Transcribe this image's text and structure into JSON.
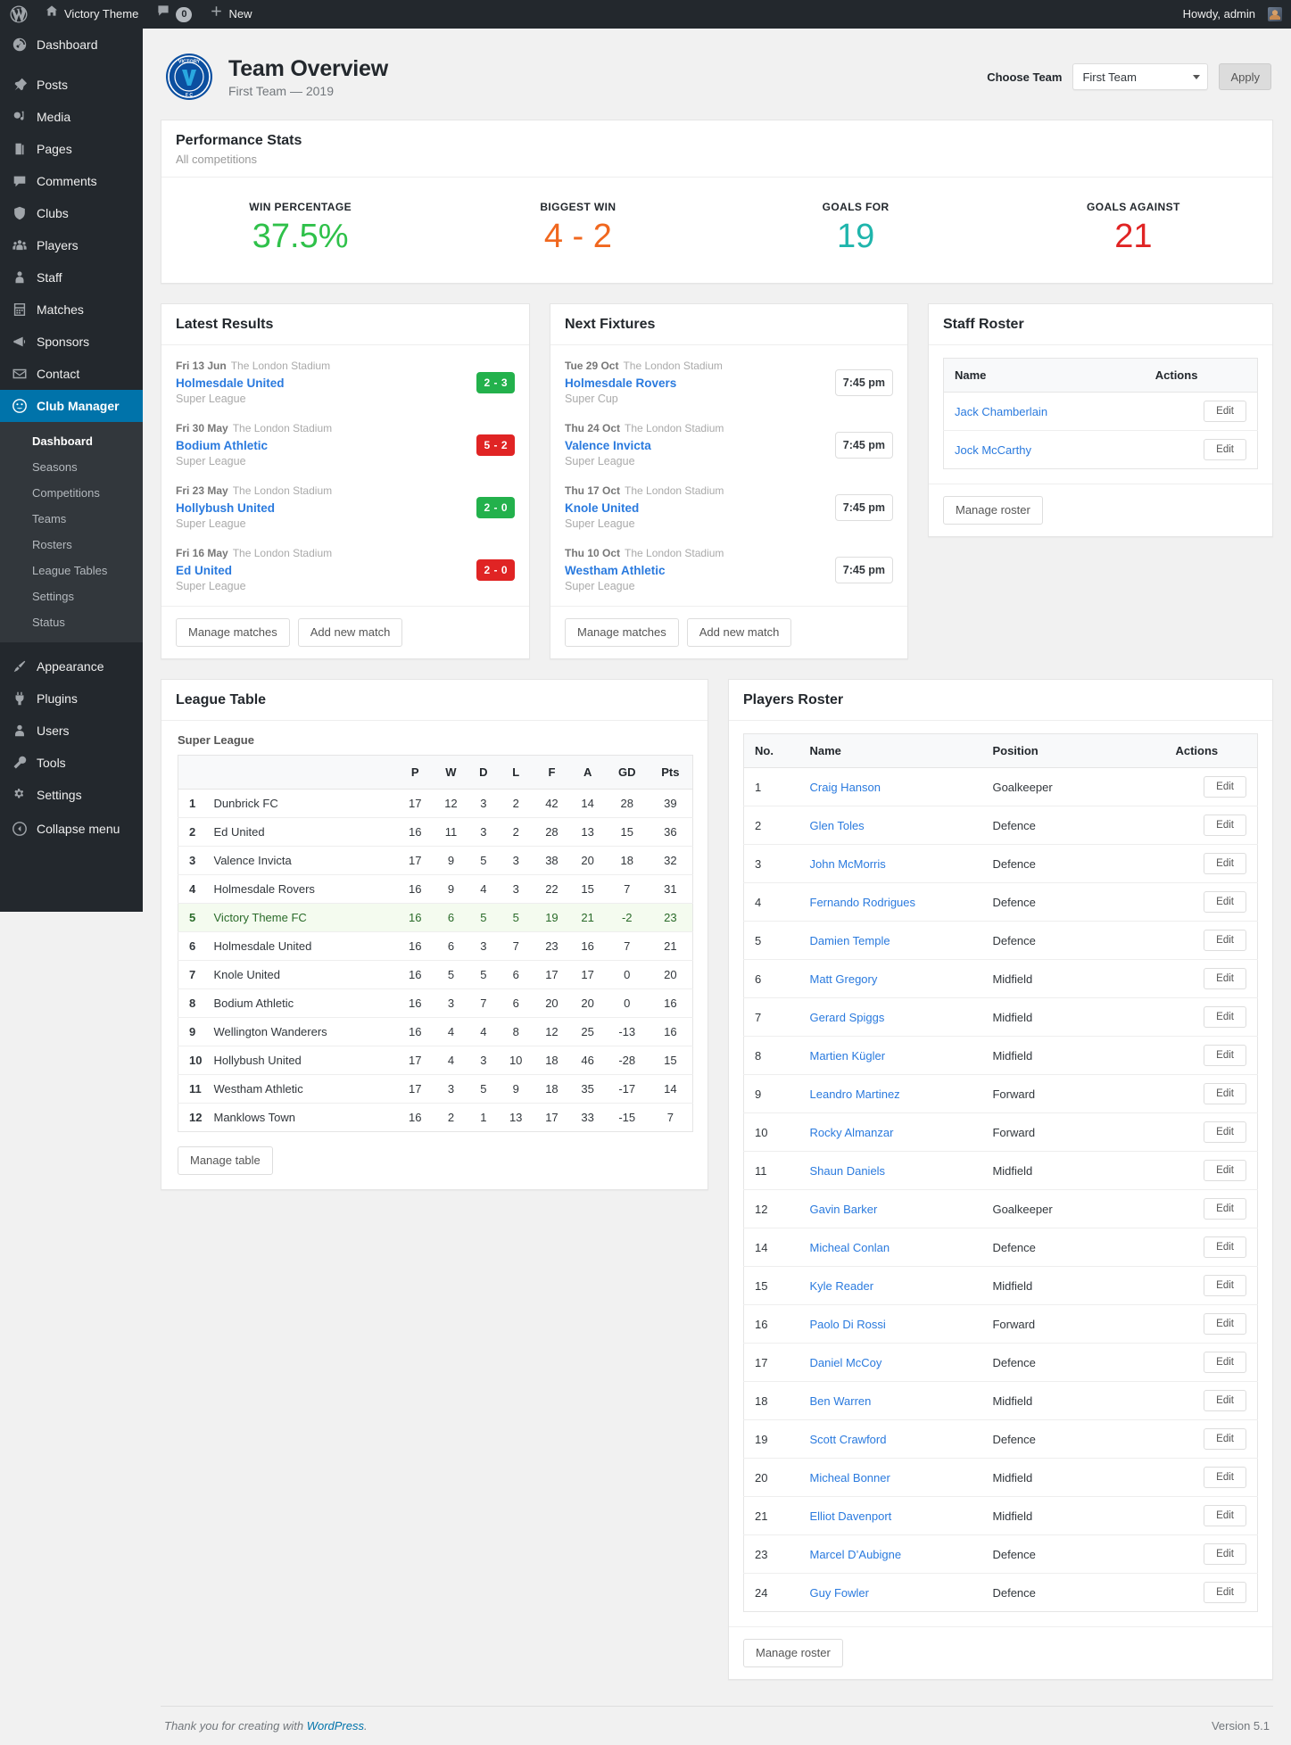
{
  "adminbar": {
    "logo_icon": "wordpress-logo-icon",
    "site_icon": "home-icon",
    "site_name": "Victory Theme",
    "comments_icon": "comment-bubble-icon",
    "comments_count": "0",
    "new_icon": "plus-icon",
    "new_label": "New",
    "howdy": "Howdy, admin",
    "avatar_icon": "user-avatar"
  },
  "sidebar": {
    "items": [
      {
        "label": "Dashboard",
        "icon": "dashboard-icon"
      },
      {
        "label": "Posts",
        "icon": "pin-icon"
      },
      {
        "label": "Media",
        "icon": "media-icon"
      },
      {
        "label": "Pages",
        "icon": "pages-icon"
      },
      {
        "label": "Comments",
        "icon": "comment-icon"
      },
      {
        "label": "Clubs",
        "icon": "shield-icon"
      },
      {
        "label": "Players",
        "icon": "group-icon"
      },
      {
        "label": "Staff",
        "icon": "person-icon"
      },
      {
        "label": "Matches",
        "icon": "calendar-icon"
      },
      {
        "label": "Sponsors",
        "icon": "megaphone-icon"
      },
      {
        "label": "Contact",
        "icon": "envelope-icon"
      }
    ],
    "club_manager": {
      "label": "Club Manager",
      "icon": "club-manager-icon"
    },
    "submenu": [
      {
        "label": "Dashboard",
        "current": true
      },
      {
        "label": "Seasons",
        "current": false
      },
      {
        "label": "Competitions",
        "current": false
      },
      {
        "label": "Teams",
        "current": false
      },
      {
        "label": "Rosters",
        "current": false
      },
      {
        "label": "League Tables",
        "current": false
      },
      {
        "label": "Settings",
        "current": false
      },
      {
        "label": "Status",
        "current": false
      }
    ],
    "bottom_items": [
      {
        "label": "Appearance",
        "icon": "paintbrush-icon"
      },
      {
        "label": "Plugins",
        "icon": "plug-icon"
      },
      {
        "label": "Users",
        "icon": "users-icon"
      },
      {
        "label": "Tools",
        "icon": "wrench-icon"
      },
      {
        "label": "Settings",
        "icon": "settings-gear-icon"
      }
    ],
    "collapse": {
      "label": "Collapse menu",
      "icon": "collapse-icon"
    }
  },
  "header": {
    "crest_icon": "victory-fc-crest",
    "title": "Team Overview",
    "subtitle": "First Team — 2019",
    "chooser_label": "Choose Team",
    "selected_team": "First Team",
    "apply_label": "Apply"
  },
  "performance": {
    "title": "Performance Stats",
    "subtitle": "All competitions",
    "stats": [
      {
        "label": "WIN PERCENTAGE",
        "value": "37.5%",
        "color": "#2fc14a"
      },
      {
        "label": "BIGGEST WIN",
        "value": "4 - 2",
        "color": "#f0671e"
      },
      {
        "label": "GOALS FOR",
        "value": "19",
        "color": "#1fb5ac"
      },
      {
        "label": "GOALS AGAINST",
        "value": "21",
        "color": "#e02424"
      }
    ]
  },
  "latest_results": {
    "title": "Latest Results",
    "matches": [
      {
        "date": "Fri 13 Jun",
        "venue": "The London Stadium",
        "team": "Holmesdale United",
        "competition": "Super League",
        "score": "2 - 3",
        "outcome": "win"
      },
      {
        "date": "Fri 30 May",
        "venue": "The London Stadium",
        "team": "Bodium Athletic",
        "competition": "Super League",
        "score": "5 - 2",
        "outcome": "loss"
      },
      {
        "date": "Fri 23 May",
        "venue": "The London Stadium",
        "team": "Hollybush United",
        "competition": "Super League",
        "score": "2 - 0",
        "outcome": "win"
      },
      {
        "date": "Fri 16 May",
        "venue": "The London Stadium",
        "team": "Ed United",
        "competition": "Super League",
        "score": "2 - 0",
        "outcome": "loss"
      }
    ],
    "manage_label": "Manage matches",
    "add_label": "Add new match"
  },
  "next_fixtures": {
    "title": "Next Fixtures",
    "matches": [
      {
        "date": "Tue 29 Oct",
        "venue": "The London Stadium",
        "team": "Holmesdale Rovers",
        "competition": "Super Cup",
        "time": "7:45 pm"
      },
      {
        "date": "Thu 24 Oct",
        "venue": "The London Stadium",
        "team": "Valence Invicta",
        "competition": "Super League",
        "time": "7:45 pm"
      },
      {
        "date": "Thu 17 Oct",
        "venue": "The London Stadium",
        "team": "Knole United",
        "competition": "Super League",
        "time": "7:45 pm"
      },
      {
        "date": "Thu 10 Oct",
        "venue": "The London Stadium",
        "team": "Westham Athletic",
        "competition": "Super League",
        "time": "7:45 pm"
      }
    ],
    "manage_label": "Manage matches",
    "add_label": "Add new match"
  },
  "staff_roster": {
    "title": "Staff Roster",
    "columns": [
      "Name",
      "Actions"
    ],
    "rows": [
      {
        "name": "Jack Chamberlain",
        "action": "Edit"
      },
      {
        "name": "Jock McCarthy",
        "action": "Edit"
      }
    ],
    "manage_label": "Manage roster"
  },
  "league_table": {
    "title": "League Table",
    "competition": "Super League",
    "columns": [
      "",
      "",
      "P",
      "W",
      "D",
      "L",
      "F",
      "A",
      "GD",
      "Pts"
    ],
    "rows": [
      {
        "pos": "1",
        "club": "Dunbrick FC",
        "p": "17",
        "w": "12",
        "d": "3",
        "l": "2",
        "f": "42",
        "a": "14",
        "gd": "28",
        "pts": "39",
        "highlight": false
      },
      {
        "pos": "2",
        "club": "Ed United",
        "p": "16",
        "w": "11",
        "d": "3",
        "l": "2",
        "f": "28",
        "a": "13",
        "gd": "15",
        "pts": "36",
        "highlight": false
      },
      {
        "pos": "3",
        "club": "Valence Invicta",
        "p": "17",
        "w": "9",
        "d": "5",
        "l": "3",
        "f": "38",
        "a": "20",
        "gd": "18",
        "pts": "32",
        "highlight": false
      },
      {
        "pos": "4",
        "club": "Holmesdale Rovers",
        "p": "16",
        "w": "9",
        "d": "4",
        "l": "3",
        "f": "22",
        "a": "15",
        "gd": "7",
        "pts": "31",
        "highlight": false
      },
      {
        "pos": "5",
        "club": "Victory Theme FC",
        "p": "16",
        "w": "6",
        "d": "5",
        "l": "5",
        "f": "19",
        "a": "21",
        "gd": "-2",
        "pts": "23",
        "highlight": true
      },
      {
        "pos": "6",
        "club": "Holmesdale United",
        "p": "16",
        "w": "6",
        "d": "3",
        "l": "7",
        "f": "23",
        "a": "16",
        "gd": "7",
        "pts": "21",
        "highlight": false
      },
      {
        "pos": "7",
        "club": "Knole United",
        "p": "16",
        "w": "5",
        "d": "5",
        "l": "6",
        "f": "17",
        "a": "17",
        "gd": "0",
        "pts": "20",
        "highlight": false
      },
      {
        "pos": "8",
        "club": "Bodium Athletic",
        "p": "16",
        "w": "3",
        "d": "7",
        "l": "6",
        "f": "20",
        "a": "20",
        "gd": "0",
        "pts": "16",
        "highlight": false
      },
      {
        "pos": "9",
        "club": "Wellington Wanderers",
        "p": "16",
        "w": "4",
        "d": "4",
        "l": "8",
        "f": "12",
        "a": "25",
        "gd": "-13",
        "pts": "16",
        "highlight": false
      },
      {
        "pos": "10",
        "club": "Hollybush United",
        "p": "17",
        "w": "4",
        "d": "3",
        "l": "10",
        "f": "18",
        "a": "46",
        "gd": "-28",
        "pts": "15",
        "highlight": false
      },
      {
        "pos": "11",
        "club": "Westham Athletic",
        "p": "17",
        "w": "3",
        "d": "5",
        "l": "9",
        "f": "18",
        "a": "35",
        "gd": "-17",
        "pts": "14",
        "highlight": false
      },
      {
        "pos": "12",
        "club": "Manklows Town",
        "p": "16",
        "w": "2",
        "d": "1",
        "l": "13",
        "f": "17",
        "a": "33",
        "gd": "-15",
        "pts": "7",
        "highlight": false
      }
    ],
    "manage_label": "Manage table"
  },
  "players_roster": {
    "title": "Players Roster",
    "columns": [
      "No.",
      "Name",
      "Position",
      "Actions"
    ],
    "rows": [
      {
        "no": "1",
        "name": "Craig Hanson",
        "position": "Goalkeeper",
        "action": "Edit"
      },
      {
        "no": "2",
        "name": "Glen Toles",
        "position": "Defence",
        "action": "Edit"
      },
      {
        "no": "3",
        "name": "John McMorris",
        "position": "Defence",
        "action": "Edit"
      },
      {
        "no": "4",
        "name": "Fernando Rodrigues",
        "position": "Defence",
        "action": "Edit"
      },
      {
        "no": "5",
        "name": "Damien Temple",
        "position": "Defence",
        "action": "Edit"
      },
      {
        "no": "6",
        "name": "Matt Gregory",
        "position": "Midfield",
        "action": "Edit"
      },
      {
        "no": "7",
        "name": "Gerard Spiggs",
        "position": "Midfield",
        "action": "Edit"
      },
      {
        "no": "8",
        "name": "Martien Kügler",
        "position": "Midfield",
        "action": "Edit"
      },
      {
        "no": "9",
        "name": "Leandro Martinez",
        "position": "Forward",
        "action": "Edit"
      },
      {
        "no": "10",
        "name": "Rocky Almanzar",
        "position": "Forward",
        "action": "Edit"
      },
      {
        "no": "11",
        "name": "Shaun Daniels",
        "position": "Midfield",
        "action": "Edit"
      },
      {
        "no": "12",
        "name": "Gavin Barker",
        "position": "Goalkeeper",
        "action": "Edit"
      },
      {
        "no": "14",
        "name": "Micheal Conlan",
        "position": "Defence",
        "action": "Edit"
      },
      {
        "no": "15",
        "name": "Kyle Reader",
        "position": "Midfield",
        "action": "Edit"
      },
      {
        "no": "16",
        "name": "Paolo Di Rossi",
        "position": "Forward",
        "action": "Edit"
      },
      {
        "no": "17",
        "name": "Daniel McCoy",
        "position": "Defence",
        "action": "Edit"
      },
      {
        "no": "18",
        "name": "Ben Warren",
        "position": "Midfield",
        "action": "Edit"
      },
      {
        "no": "19",
        "name": "Scott Crawford",
        "position": "Defence",
        "action": "Edit"
      },
      {
        "no": "20",
        "name": "Micheal Bonner",
        "position": "Midfield",
        "action": "Edit"
      },
      {
        "no": "21",
        "name": "Elliot Davenport",
        "position": "Midfield",
        "action": "Edit"
      },
      {
        "no": "23",
        "name": "Marcel D’Aubigne",
        "position": "Defence",
        "action": "Edit"
      },
      {
        "no": "24",
        "name": "Guy Fowler",
        "position": "Defence",
        "action": "Edit"
      }
    ],
    "manage_label": "Manage roster"
  },
  "footer": {
    "thanks_prefix": "Thank you for creating with ",
    "wordpress_link": "WordPress",
    "thanks_suffix": ".",
    "version": "Version 5.1"
  }
}
